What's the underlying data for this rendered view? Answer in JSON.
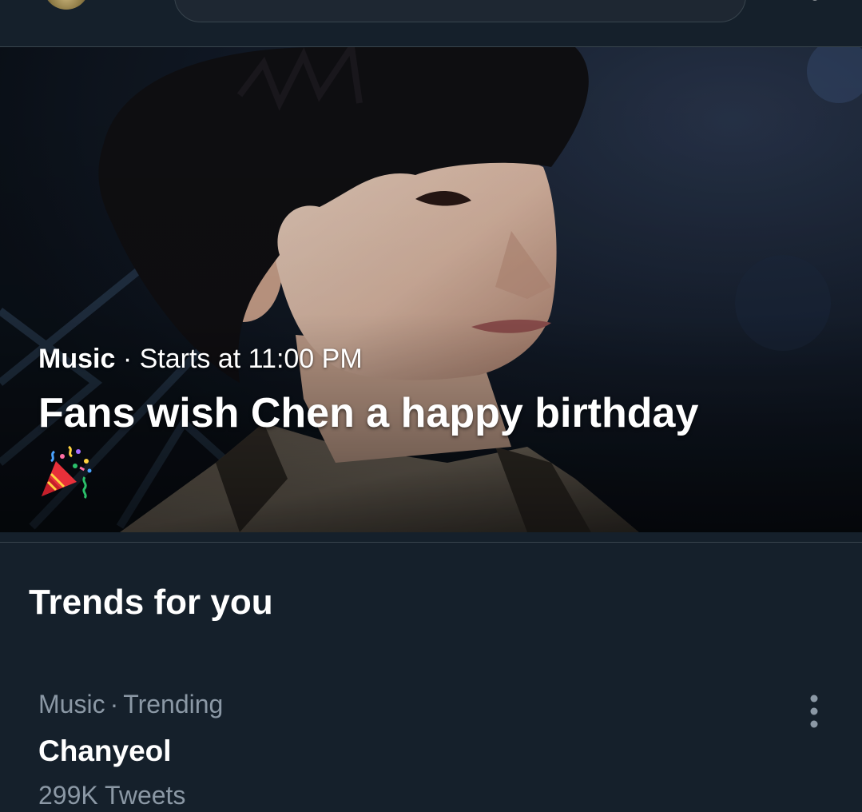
{
  "header": {
    "avatar_icon": "user-avatar",
    "search_icon": "search-field",
    "settings_icon": "settings-icon"
  },
  "event": {
    "category": "Music",
    "separator": "·",
    "time": "Starts at 11:00 PM",
    "title": "Fans wish Chen a happy birthday",
    "emoji": "party-popper-icon"
  },
  "trends": {
    "section_title": "Trends for you",
    "items": [
      {
        "category": "Music",
        "separator": "·",
        "status": "Trending",
        "name": "Chanyeol",
        "count": "299K Tweets",
        "more_icon": "more-vertical-icon"
      }
    ]
  },
  "colors": {
    "background": "#15202b",
    "border": "#38444d",
    "secondary_text": "#8b98a5",
    "primary_text": "#ffffff"
  }
}
